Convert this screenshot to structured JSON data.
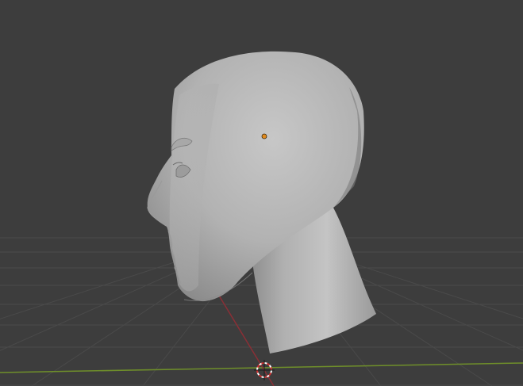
{
  "viewport": {
    "background_color": "#3d3d3d",
    "grid_color": "#4a4a4a",
    "x_axis_color": "#8a2f36",
    "y_axis_color": "#6f8f2a",
    "selected_object": "head",
    "object_color": "#b4b4b4",
    "origin_marker_color": "#e08a1e",
    "icons": {
      "origin": "object-origin-icon",
      "cursor": "3d-cursor-icon"
    }
  }
}
